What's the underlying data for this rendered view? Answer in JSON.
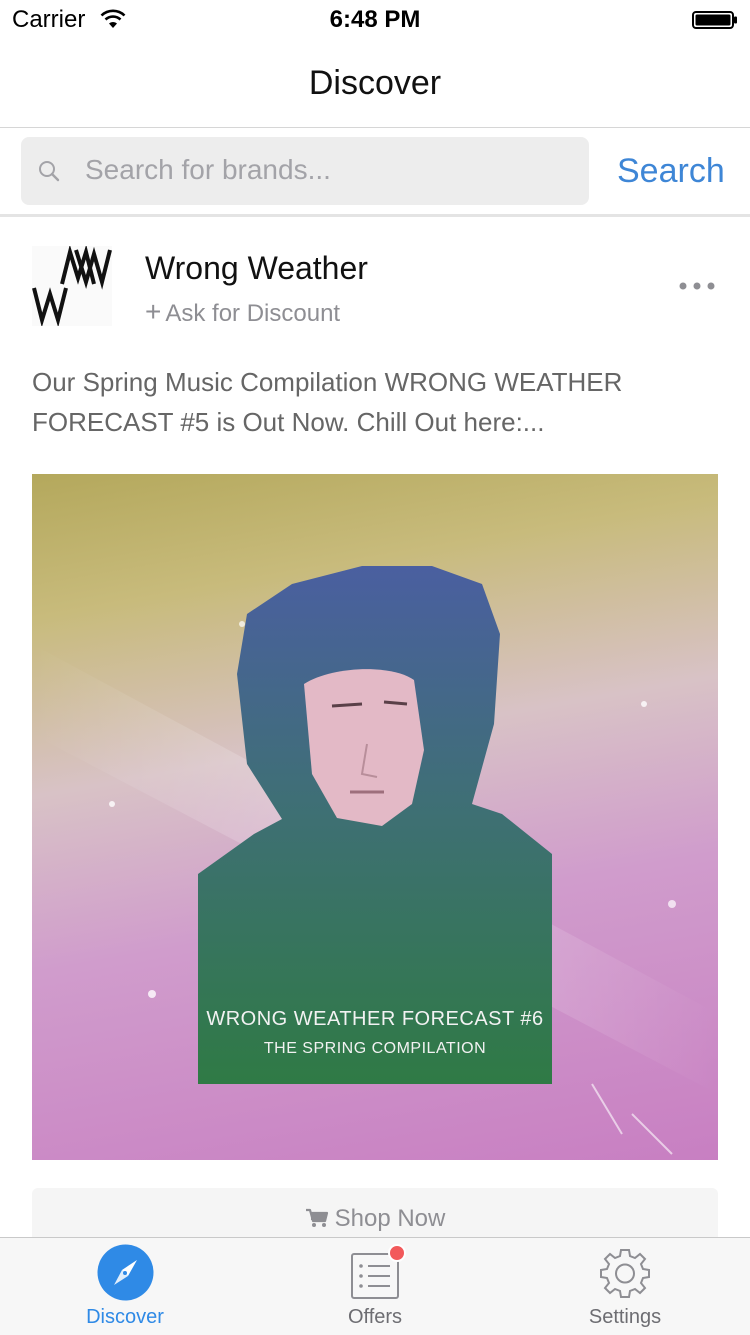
{
  "status_bar": {
    "carrier": "Carrier",
    "time": "6:48 PM"
  },
  "nav": {
    "title": "Discover"
  },
  "search": {
    "placeholder": "Search for brands...",
    "button_label": "Search"
  },
  "post": {
    "brand_name": "Wrong Weather",
    "ask_discount_label": "Ask for Discount",
    "text": "Our Spring Music Compilation WRONG WEATHER FORECAST #5 is Out Now. Chill Out here:...",
    "image_title": "WRONG WEATHER FORECAST #6",
    "image_subtitle": "THE SPRING COMPILATION",
    "shop_label": "Shop Now"
  },
  "tabs": [
    {
      "label": "Discover",
      "icon": "compass-icon",
      "active": true
    },
    {
      "label": "Offers",
      "icon": "list-icon",
      "badge": true
    },
    {
      "label": "Settings",
      "icon": "gear-icon"
    }
  ],
  "colors": {
    "accent": "#3e86d6",
    "inactive": "#8e8e93",
    "badge": "#f2595b"
  }
}
